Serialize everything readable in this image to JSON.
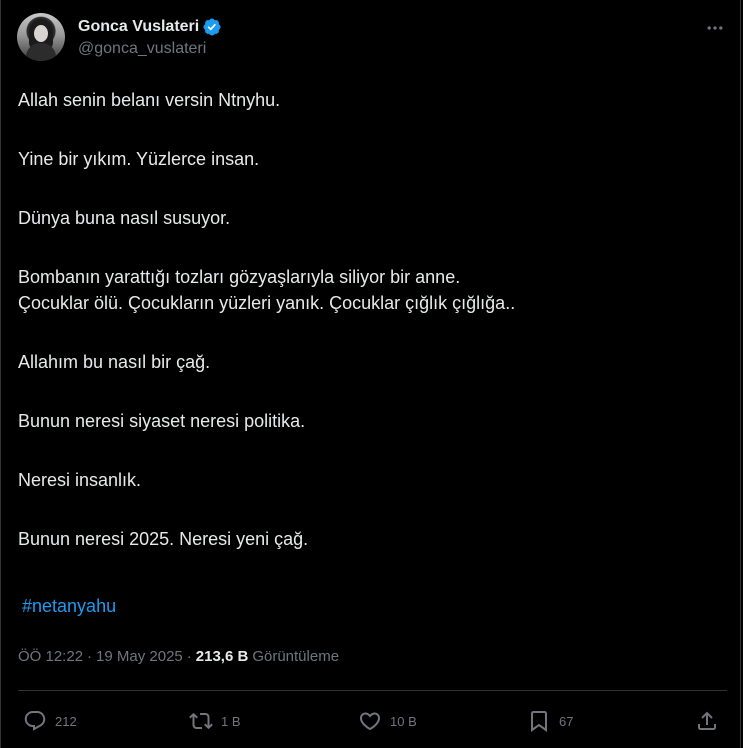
{
  "author": {
    "display_name": "Gonca Vuslateri",
    "handle": "@gonca_vuslateri",
    "verified": true,
    "avatar_icon": "profile-photo",
    "verified_color": "#1d9bf0"
  },
  "more_icon": "ellipsis-icon",
  "tweet": {
    "paragraphs": [
      [
        "Allah senin belanı versin Ntnyhu."
      ],
      [
        "Yine bir yıkım. Yüzlerce insan."
      ],
      [
        "Dünya buna nasıl susuyor."
      ],
      [
        "Bombanın yarattığı tozları gözyaşlarıyla siliyor bir anne.",
        "Çocuklar ölü. Çocukların yüzleri yanık. Çocuklar çığlık çığlığa.."
      ],
      [
        "Allahım bu nasıl bir çağ."
      ],
      [
        "Bunun neresi siyaset neresi politika."
      ],
      [
        "Neresi insanlık."
      ],
      [
        "Bunun neresi 2025. Neresi yeni çağ."
      ]
    ],
    "hashtag": "#netanyahu",
    "hashtag_color": "#1d9bf0"
  },
  "meta": {
    "time": "ÖÖ 12:22",
    "separator": "·",
    "date": "19 May 2025",
    "views_count": "213,6 B",
    "views_label": "Görüntüleme"
  },
  "actions": {
    "reply": {
      "icon": "reply-icon",
      "count": "212"
    },
    "retweet": {
      "icon": "retweet-icon",
      "count": "1 B"
    },
    "like": {
      "icon": "heart-icon",
      "count": "10 B"
    },
    "bookmark": {
      "icon": "bookmark-icon",
      "count": "67"
    },
    "share": {
      "icon": "share-icon"
    }
  },
  "colors": {
    "background": "#000000",
    "text": "#e7e9ea",
    "secondary": "#71767b",
    "border": "#2f3336"
  }
}
